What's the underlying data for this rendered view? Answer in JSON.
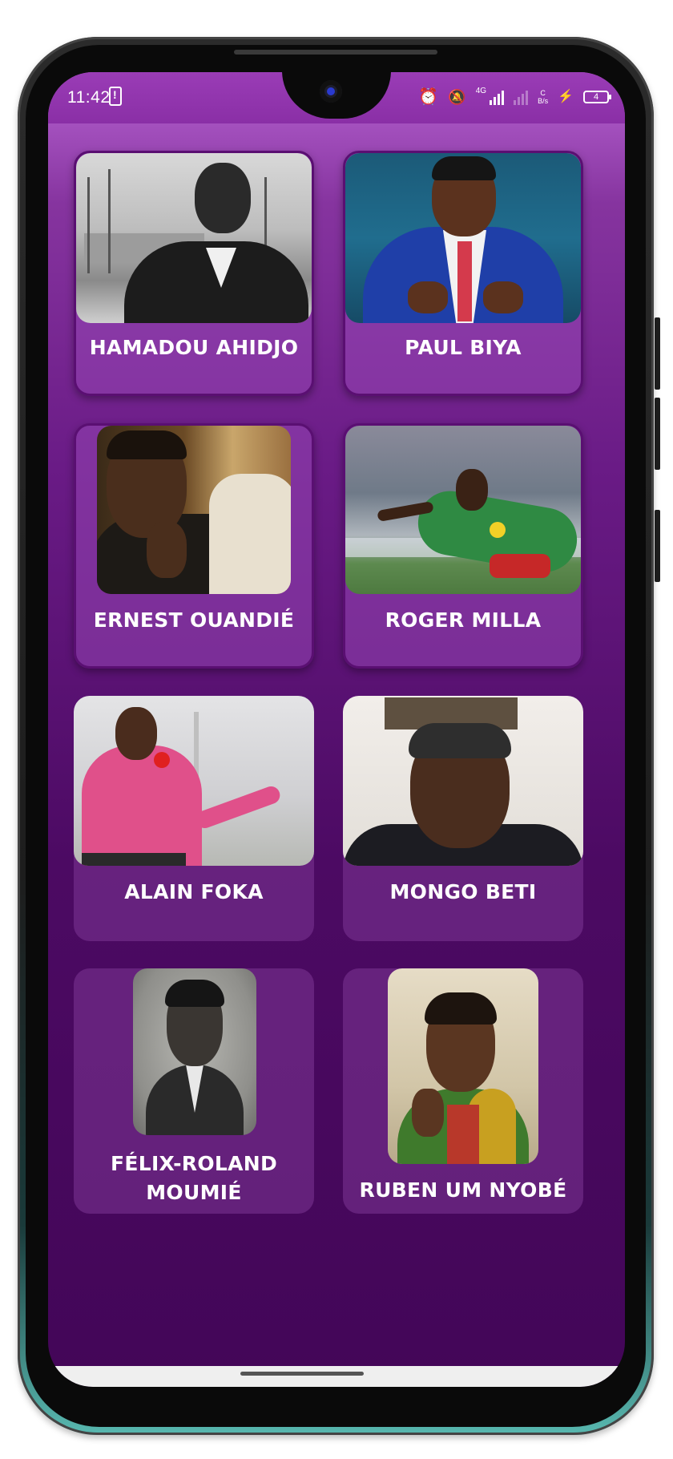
{
  "status_bar": {
    "time": "11:42",
    "network": "4G",
    "net_speed_top": "C",
    "net_speed_bottom": "B/s",
    "battery": "4"
  },
  "personalities": [
    {
      "name": "HAMADOU AHIDJO"
    },
    {
      "name": "PAUL BIYA"
    },
    {
      "name": "ERNEST OUANDIÉ"
    },
    {
      "name": "ROGER MILLA"
    },
    {
      "name": "ALAIN FOKA"
    },
    {
      "name": "MONGO BETI"
    },
    {
      "name_line1": "FÉLIX-ROLAND",
      "name_line2": "MOUMIÉ"
    },
    {
      "name": "RUBEN UM NYOBÉ"
    }
  ],
  "colors": {
    "background_top": "#b763d2",
    "background_bottom": "#430658",
    "card_border": "#5a0f72",
    "label_text": "#ffffff"
  }
}
